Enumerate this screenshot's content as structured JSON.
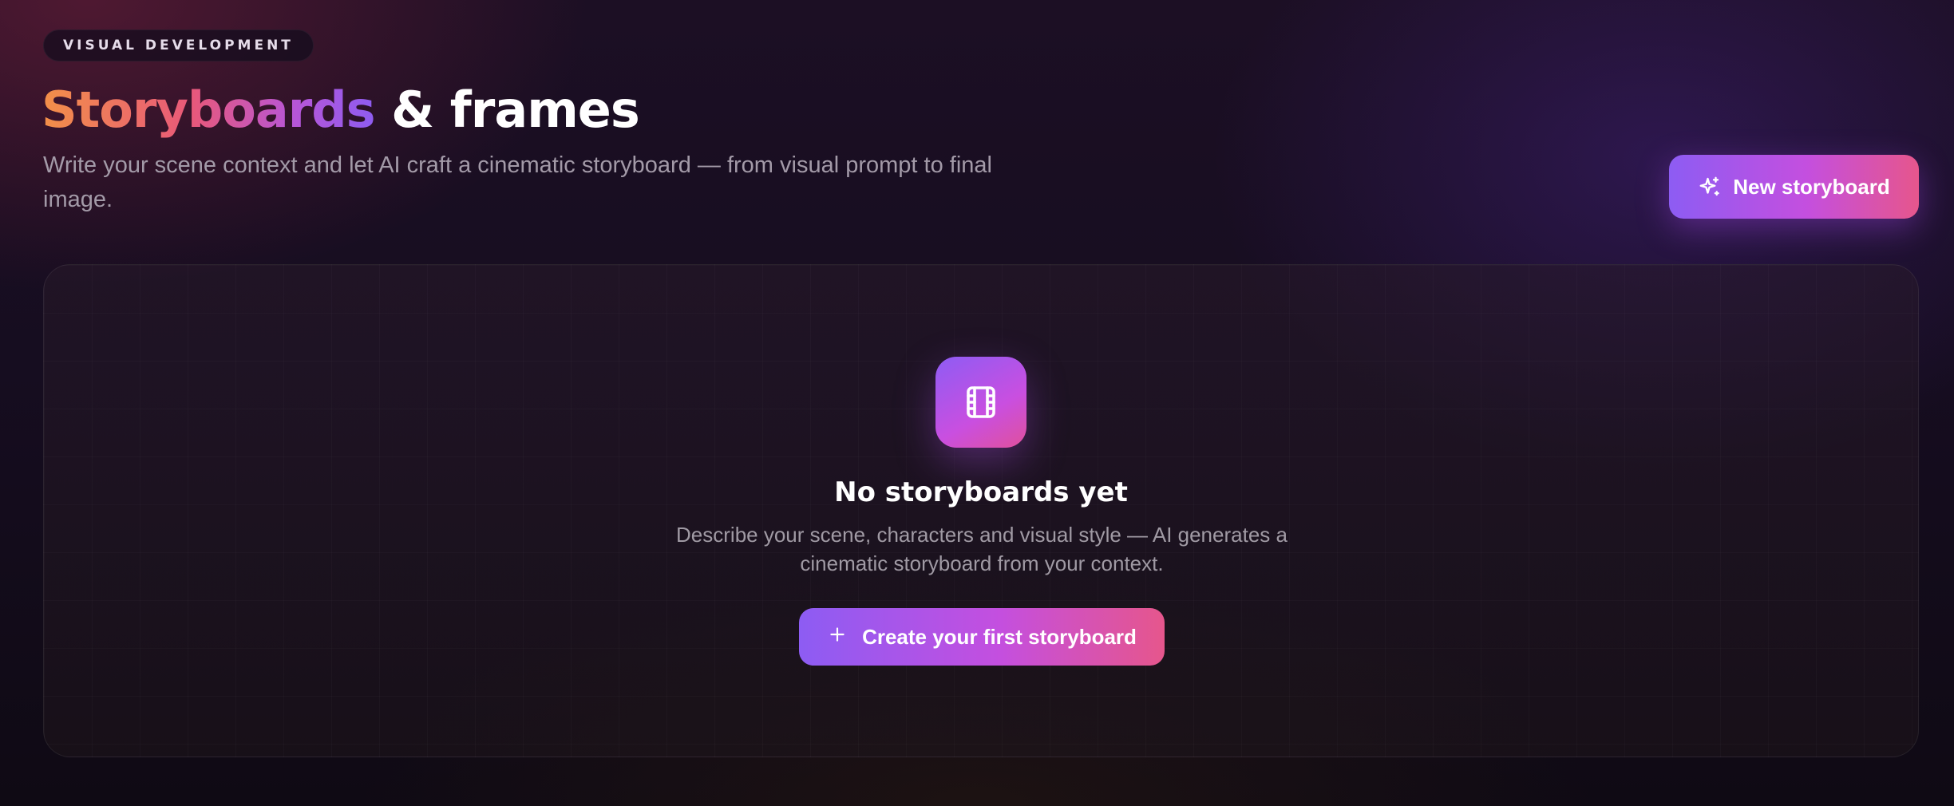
{
  "header": {
    "eyebrow": "VISUAL DEVELOPMENT",
    "title_accent": "Storyboards",
    "title_rest": " & frames",
    "subtitle": "Write your scene context and let AI craft a cinematic storyboard — from visual prompt to final image.",
    "new_button_label": "New storyboard",
    "new_button_icon": "sparkles-icon"
  },
  "empty_state": {
    "icon": "film-icon",
    "title": "No storyboards yet",
    "description": "Describe your scene, characters and visual style — AI generates a cinematic storyboard from your context.",
    "cta_label": "Create your first storyboard",
    "cta_icon": "plus-icon"
  },
  "colors": {
    "accent_start": "#8d5cf3",
    "accent_mid": "#c44fdf",
    "accent_end": "#e6568c",
    "title_gradient_start": "#f39048",
    "muted_text": "#a39aa8",
    "background": "#130b1c"
  }
}
